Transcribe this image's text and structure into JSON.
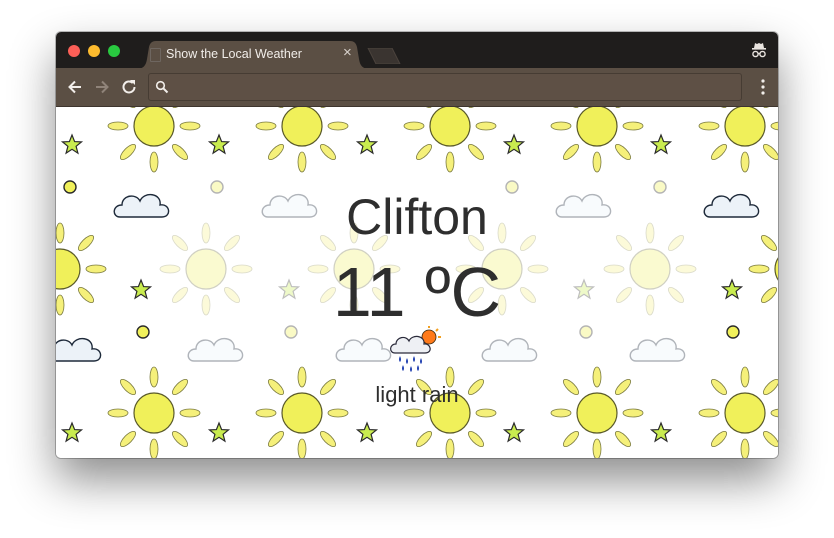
{
  "browser": {
    "tab": {
      "title": "Show the Local Weather",
      "close_glyph": "×",
      "favicon": "page-icon"
    },
    "toolbar": {
      "back_icon": "arrow-left-icon",
      "forward_icon": "arrow-right-icon",
      "reload_icon": "reload-icon",
      "search_icon": "search-icon",
      "address_value": "",
      "menu_icon": "vertical-dots-icon"
    },
    "mode_icon": "incognito-icon",
    "colors": {
      "tabstrip": "#1f1d1c",
      "active_tab": "#5b4f44",
      "toolbar": "#5b4f44"
    }
  },
  "weather": {
    "city": "Clifton",
    "temperature": "11 ºC",
    "icon": "rain-cloud-sun-icon",
    "description": "light rain"
  },
  "background": {
    "pattern": "suns-stars-clouds",
    "colors": {
      "sun": "#f0f05a",
      "star": "#c9ec4f",
      "cloud": "#dde7f2"
    }
  }
}
